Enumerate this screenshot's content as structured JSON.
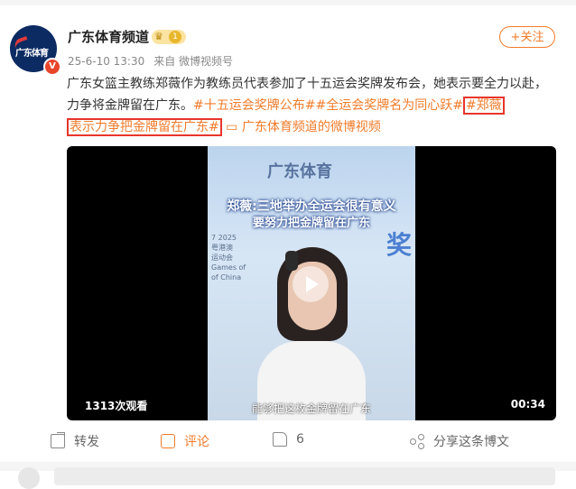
{
  "post": {
    "author": "广东体育频道",
    "avatar_text": "广东体育",
    "verified_mark": "V",
    "crown_level": "1",
    "follow_label": "+关注",
    "time": "25-6-10 13:30",
    "source": "来自 微博视频号",
    "text": {
      "intro": "广东女篮主教练郑薇作为教练员代表参加了十五运会奖牌发布会，她表示要全力以赴，力争将金牌留在广东。",
      "tag1": "#十五运会奖牌公布#",
      "tag2": "#全运会奖牌名为同心跃#",
      "tag3_part1": "#郑薇",
      "tag3_part2": "表示力争把金牌留在广东#",
      "video_link": "广东体育频道的微博视频"
    }
  },
  "video": {
    "brand": "广东体育",
    "title_line1": "郑薇:三地举办全运会很有意义",
    "title_line2": "要努力把金牌留在广东",
    "background_char": "奖",
    "side_text": "7 2025\n粤港澳\n运动会\nGames of\nof China",
    "subtitle": "能够把这枚金牌留在广东",
    "views": "1313次观看",
    "duration": "00:34"
  },
  "actions": {
    "forward": "转发",
    "comment": "评论",
    "like_count": "6",
    "share": "分享这条博文"
  },
  "colors": {
    "accent": "#f07c2b",
    "highlight_box": "#e8352b",
    "badge_red": "#e8452c"
  }
}
